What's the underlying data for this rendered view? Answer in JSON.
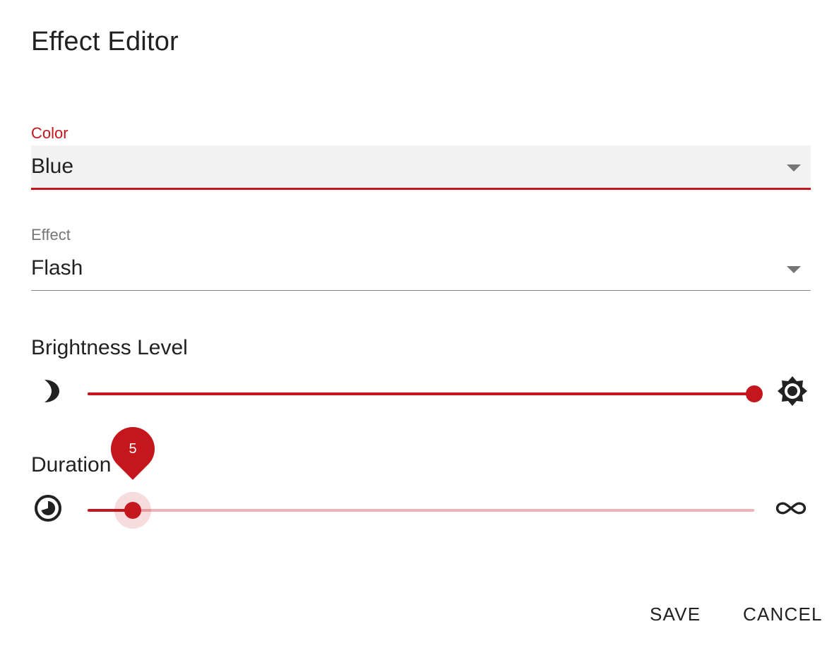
{
  "dialog": {
    "title": "Effect Editor"
  },
  "color_field": {
    "label": "Color",
    "value": "Blue"
  },
  "effect_field": {
    "label": "Effect",
    "value": "Flash"
  },
  "brightness": {
    "label": "Brightness Level",
    "value_fraction": 1.0,
    "min_icon": "moon-icon",
    "max_icon": "sun-icon"
  },
  "duration": {
    "label": "Duration",
    "value": 5,
    "value_display": "5",
    "value_fraction": 0.068,
    "min_icon": "timelapse-icon",
    "max_icon": "infinity-icon"
  },
  "actions": {
    "save_label": "SAVE",
    "cancel_label": "CANCEL"
  },
  "colors": {
    "accent": "#c4161c",
    "accent_light": "#eeb3b4",
    "field_bg": "#f2f2f2",
    "text": "#212121",
    "muted": "#757575"
  }
}
